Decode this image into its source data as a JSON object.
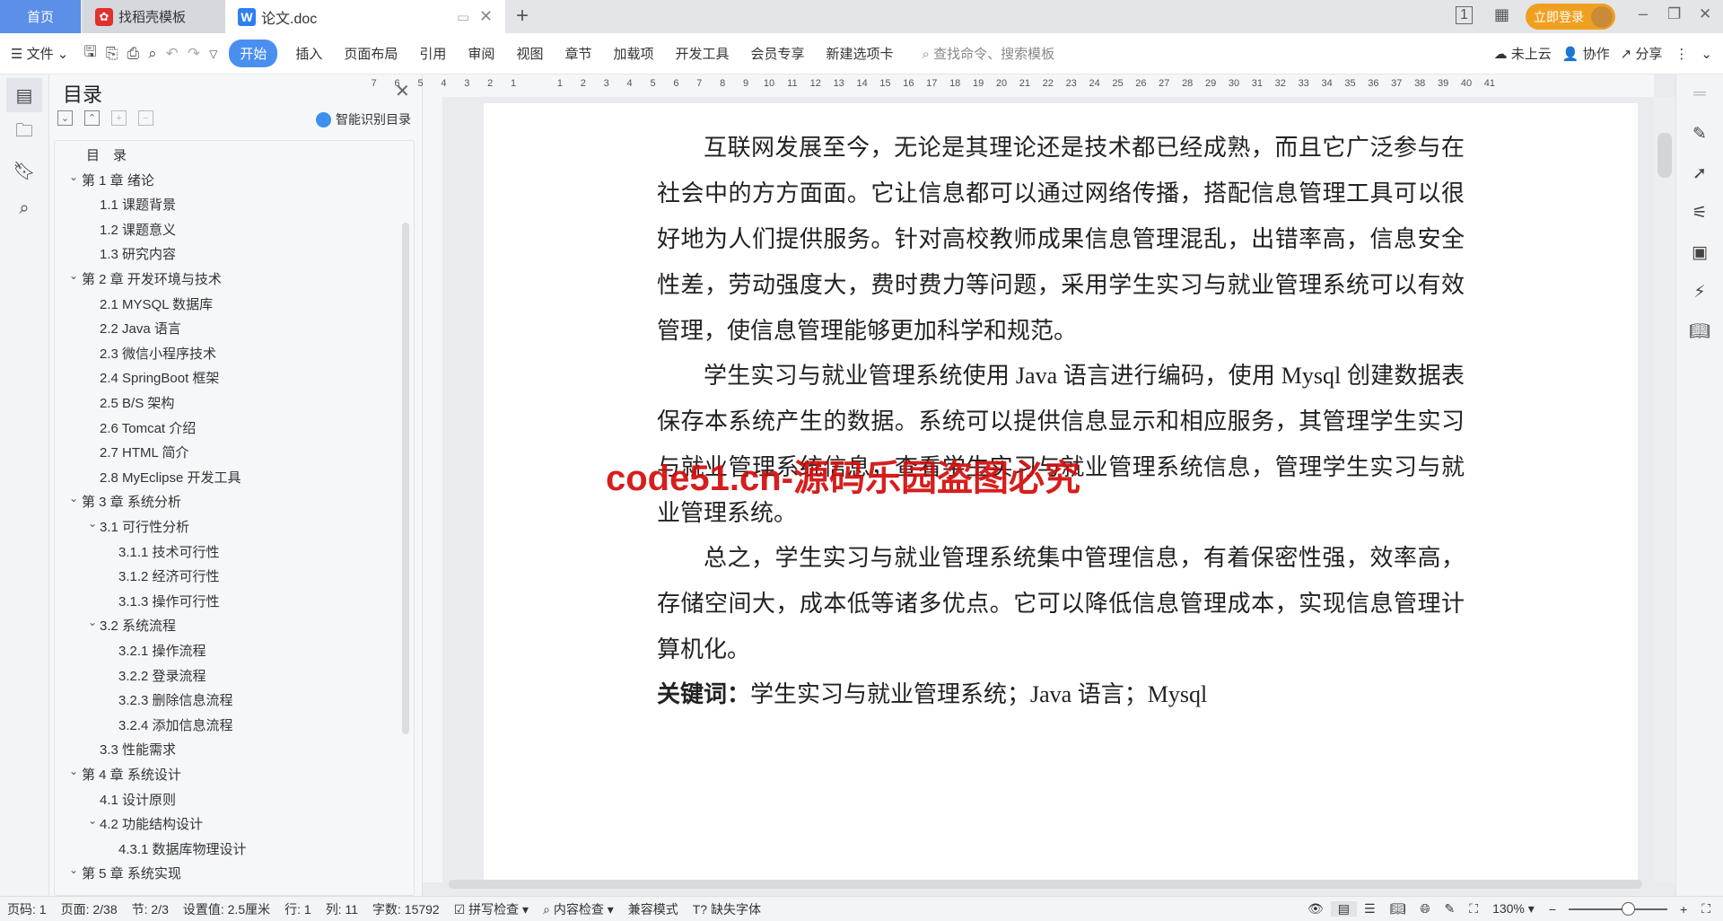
{
  "tabs": [
    {
      "label": "首页"
    },
    {
      "label": "找稻壳模板"
    },
    {
      "label": "论文.doc"
    }
  ],
  "window": {
    "login": "立即登录"
  },
  "toolbar": {
    "file": "文件",
    "menus": [
      "开始",
      "插入",
      "页面布局",
      "引用",
      "审阅",
      "视图",
      "章节",
      "加载项",
      "开发工具",
      "会员专享",
      "新建选项卡"
    ],
    "active": "开始",
    "search_placeholder": "查找命令、搜索模板",
    "cloud": "未上云",
    "collab": "协作",
    "share": "分享"
  },
  "ruler": {
    "left": [
      "7",
      "6",
      "5",
      "4",
      "3",
      "2",
      "1"
    ],
    "right": [
      "1",
      "2",
      "3",
      "4",
      "5",
      "6",
      "7",
      "8",
      "9",
      "10",
      "11",
      "12",
      "13",
      "14",
      "15",
      "16",
      "17",
      "18",
      "19",
      "20",
      "21",
      "22",
      "23",
      "24",
      "25",
      "26",
      "27",
      "28",
      "29",
      "30",
      "31",
      "32",
      "33",
      "34",
      "35",
      "36",
      "37",
      "38",
      "39",
      "40",
      "41"
    ]
  },
  "toc": {
    "title": "目录",
    "smart": "智能识别目录",
    "items": [
      {
        "label": "目　录",
        "level": 0,
        "chev": false
      },
      {
        "label": "第 1 章  绪论",
        "level": 1,
        "chev": true
      },
      {
        "label": "1.1  课题背景",
        "level": 2,
        "chev": false
      },
      {
        "label": "1.2  课题意义",
        "level": 2,
        "chev": false
      },
      {
        "label": "1.3  研究内容",
        "level": 2,
        "chev": false
      },
      {
        "label": "第 2 章  开发环境与技术",
        "level": 1,
        "chev": true
      },
      {
        "label": "2.1 MYSQL 数据库",
        "level": 2,
        "chev": false
      },
      {
        "label": "2.2 Java 语言",
        "level": 2,
        "chev": false
      },
      {
        "label": "2.3  微信小程序技术",
        "level": 2,
        "chev": false
      },
      {
        "label": "2.4 SpringBoot 框架",
        "level": 2,
        "chev": false
      },
      {
        "label": "2.5 B/S 架构",
        "level": 2,
        "chev": false
      },
      {
        "label": "2.6 Tomcat  介绍",
        "level": 2,
        "chev": false
      },
      {
        "label": "2.7 HTML 简介",
        "level": 2,
        "chev": false
      },
      {
        "label": "2.8 MyEclipse 开发工具",
        "level": 2,
        "chev": false
      },
      {
        "label": "第 3 章  系统分析",
        "level": 1,
        "chev": true
      },
      {
        "label": "3.1  可行性分析",
        "level": 2,
        "chev": true
      },
      {
        "label": "3.1.1  技术可行性",
        "level": 3,
        "chev": false
      },
      {
        "label": "3.1.2  经济可行性",
        "level": 3,
        "chev": false
      },
      {
        "label": "3.1.3  操作可行性",
        "level": 3,
        "chev": false
      },
      {
        "label": "3.2  系统流程",
        "level": 2,
        "chev": true
      },
      {
        "label": "3.2.1  操作流程",
        "level": 3,
        "chev": false
      },
      {
        "label": "3.2.2  登录流程",
        "level": 3,
        "chev": false
      },
      {
        "label": "3.2.3  删除信息流程",
        "level": 3,
        "chev": false
      },
      {
        "label": "3.2.4  添加信息流程",
        "level": 3,
        "chev": false
      },
      {
        "label": "3.3  性能需求",
        "level": 2,
        "chev": false
      },
      {
        "label": "第 4 章  系统设计",
        "level": 1,
        "chev": true
      },
      {
        "label": "4.1  设计原则",
        "level": 2,
        "chev": false
      },
      {
        "label": "4.2  功能结构设计",
        "level": 2,
        "chev": true
      },
      {
        "label": "4.3.1  数据库物理设计",
        "level": 3,
        "chev": false
      },
      {
        "label": "第 5 章  系统实现",
        "level": 1,
        "chev": true
      }
    ]
  },
  "document": {
    "paragraphs": [
      "互联网发展至今，无论是其理论还是技术都已经成熟，而且它广泛参与在社会中的方方面面。它让信息都可以通过网络传播，搭配信息管理工具可以很好地为人们提供服务。针对高校教师成果信息管理混乱，出错率高，信息安全性差，劳动强度大，费时费力等问题，采用学生实习与就业管理系统可以有效管理，使信息管理能够更加科学和规范。",
      "学生实习与就业管理系统使用 Java 语言进行编码，使用 Mysql 创建数据表保存本系统产生的数据。系统可以提供信息显示和相应服务，其管理学生实习与就业管理系统信息，查看学生实习与就业管理系统信息，管理学生实习与就业管理系统。",
      "总之，学生实习与就业管理系统集中管理信息，有着保密性强，效率高，存储空间大，成本低等诸多优点。它可以降低信息管理成本，实现信息管理计算机化。"
    ],
    "keywords_label": "关键词：",
    "keywords": "学生实习与就业管理系统；Java 语言；Mysql"
  },
  "watermark": "code51.cn-源码乐园盗图必究",
  "status": {
    "page_no": "页码: 1",
    "page": "页面: 2/38",
    "section": "节: 2/3",
    "setting": "设置值: 2.5厘米",
    "row": "行: 1",
    "col": "列: 11",
    "words": "字数: 15792",
    "spell": "拼写检查",
    "content": "内容检查",
    "compat": "兼容模式",
    "missing_font": "缺失字体",
    "zoom": "130%",
    "zoom_fraction": 0.6
  },
  "colors": {
    "accent": "#4a8ff0",
    "home_tab": "#5b8fe8",
    "login": "#f0a020",
    "watermark": "#d40c0c"
  }
}
